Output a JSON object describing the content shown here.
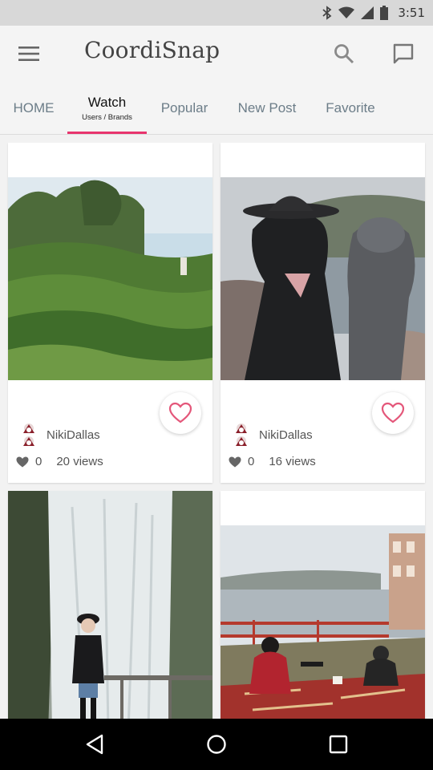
{
  "status_bar": {
    "time": "3:51"
  },
  "app_bar": {
    "title": "CoordiSnap",
    "menu_icon": "hamburger-menu-icon",
    "search_icon": "search-icon",
    "message_icon": "message-icon"
  },
  "tabs": [
    {
      "label": "HOME",
      "sub": ""
    },
    {
      "label": "Watch",
      "sub": "Users / Brands"
    },
    {
      "label": "Popular",
      "sub": ""
    },
    {
      "label": "New Post",
      "sub": ""
    },
    {
      "label": "Favorite",
      "sub": ""
    }
  ],
  "active_tab": "Watch",
  "posts": [
    {
      "user": "NikiDallas",
      "likes": "0",
      "views": "20 views",
      "photo": "tea-field-photo"
    },
    {
      "user": "NikiDallas",
      "likes": "0",
      "views": "16 views",
      "photo": "two-people-lake-photo"
    },
    {
      "user": "",
      "likes": "",
      "views": "",
      "photo": "waterfall-photo"
    },
    {
      "user": "",
      "likes": "",
      "views": "",
      "photo": "picnic-lake-photo"
    }
  ],
  "colors": {
    "accent": "#e8356e",
    "heart": "#e4577a",
    "tab_text": "#6c7d88"
  },
  "nav": {
    "back_icon": "back-icon",
    "home_icon": "home-icon",
    "recents_icon": "recents-icon"
  }
}
